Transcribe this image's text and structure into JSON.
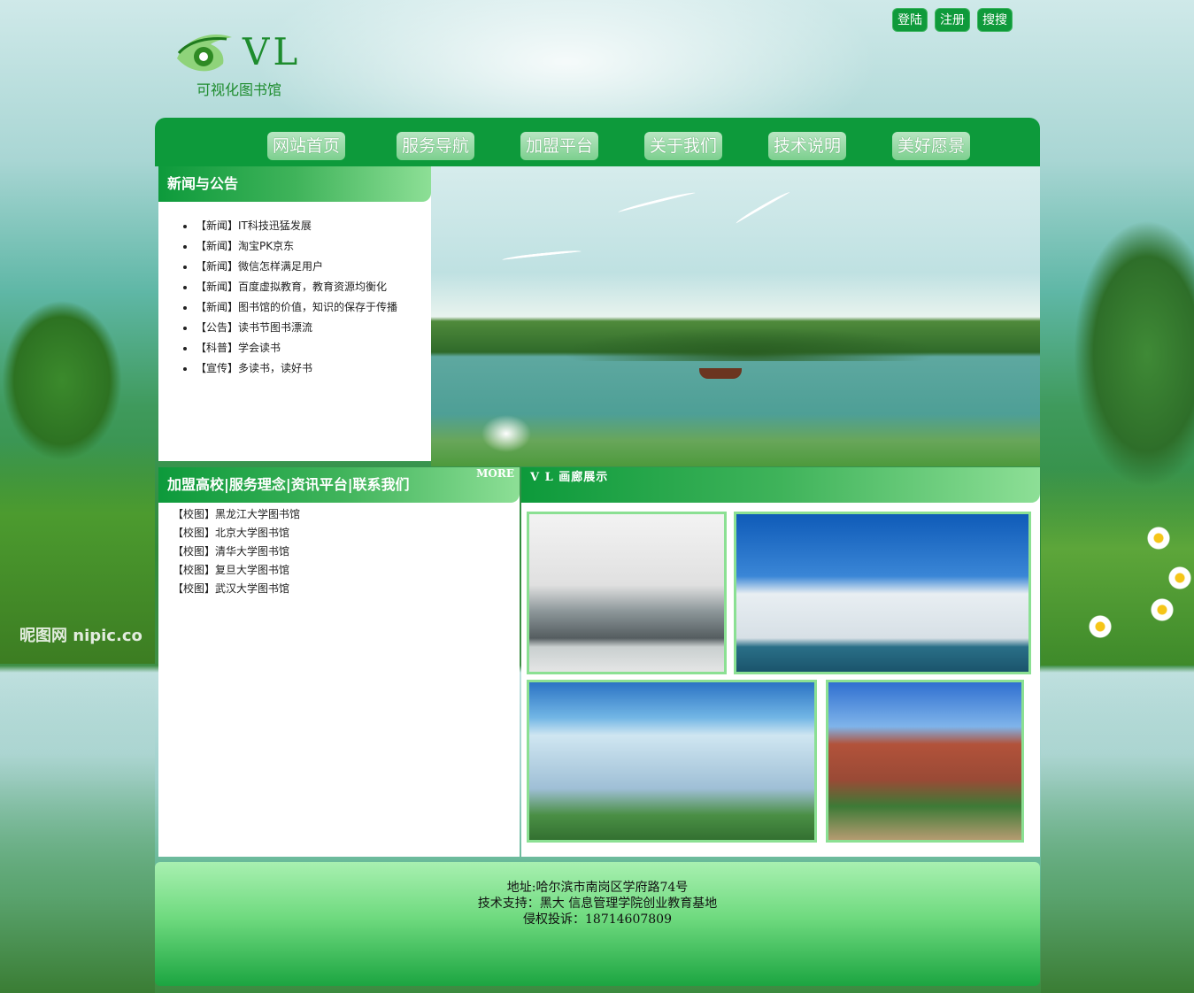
{
  "header": {
    "logo_letters": "VL",
    "logo_sub": "可视化图书馆",
    "top_links": [
      "登陆",
      "注册",
      "搜搜"
    ]
  },
  "nav": {
    "items": [
      "网站首页",
      "服务导航",
      "加盟平台",
      "关于我们",
      "技术说明",
      "美好愿景"
    ]
  },
  "news": {
    "title": "新闻与公告",
    "items": [
      "【新闻】IT科技迅猛发展",
      "【新闻】淘宝PK京东",
      "【新闻】微信怎样满足用户",
      "【新闻】百度虚拟教育，教育资源均衡化",
      "【新闻】图书馆的价值，知识的保存于传播",
      "【公告】读书节图书漂流",
      "【科普】学会读书",
      "【宣传】多读书，读好书"
    ]
  },
  "links": {
    "title": "加盟高校|服务理念|资讯平台|联系我们",
    "more": "MORE",
    "items": [
      "【校图】黑龙江大学图书馆",
      "【校图】北京大学图书馆",
      "【校图】清华大学图书馆",
      "【校图】复旦大学图书馆",
      "【校图】武汉大学图书馆"
    ]
  },
  "gallery": {
    "title": "V L 画廊展示"
  },
  "footer": {
    "address": "地址:哈尔滨市南岗区学府路74号",
    "support": "技术支持：黑大 信息管理学院创业教育基地",
    "complaint": "侵权投诉：18714607809"
  },
  "background": {
    "watermark": "昵图网 nipic.co"
  },
  "colors": {
    "primary_green": "#0d9a3b",
    "light_green": "#8ddf96",
    "photo_border": "#8be093"
  }
}
